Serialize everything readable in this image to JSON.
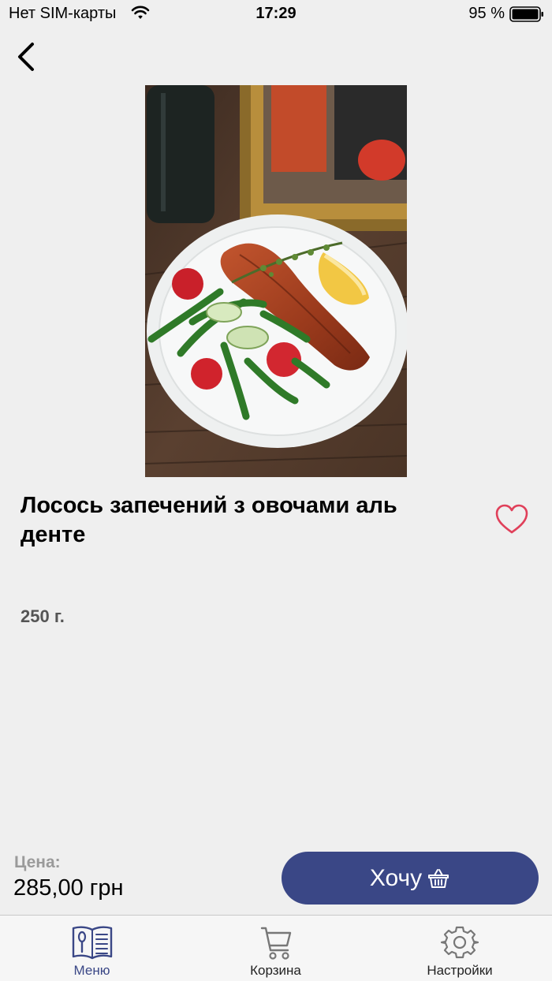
{
  "status_bar": {
    "carrier": "Нет SIM-карты",
    "time": "17:29",
    "battery": "95 %"
  },
  "dish": {
    "title": "Лосось запечений з овочами аль денте",
    "weight": "250 г.",
    "image_icon": "salmon-dish-photo"
  },
  "order": {
    "price_label": "Цена:",
    "price": "285,00 грн",
    "want_label": "Хочу"
  },
  "tabs": [
    {
      "label": "Меню",
      "icon": "menu-book-icon",
      "active": true
    },
    {
      "label": "Корзина",
      "icon": "cart-icon",
      "active": false
    },
    {
      "label": "Настройки",
      "icon": "gear-icon",
      "active": false
    }
  ],
  "colors": {
    "accent": "#3a4786",
    "heart": "#e0405a",
    "background": "#efefef"
  }
}
